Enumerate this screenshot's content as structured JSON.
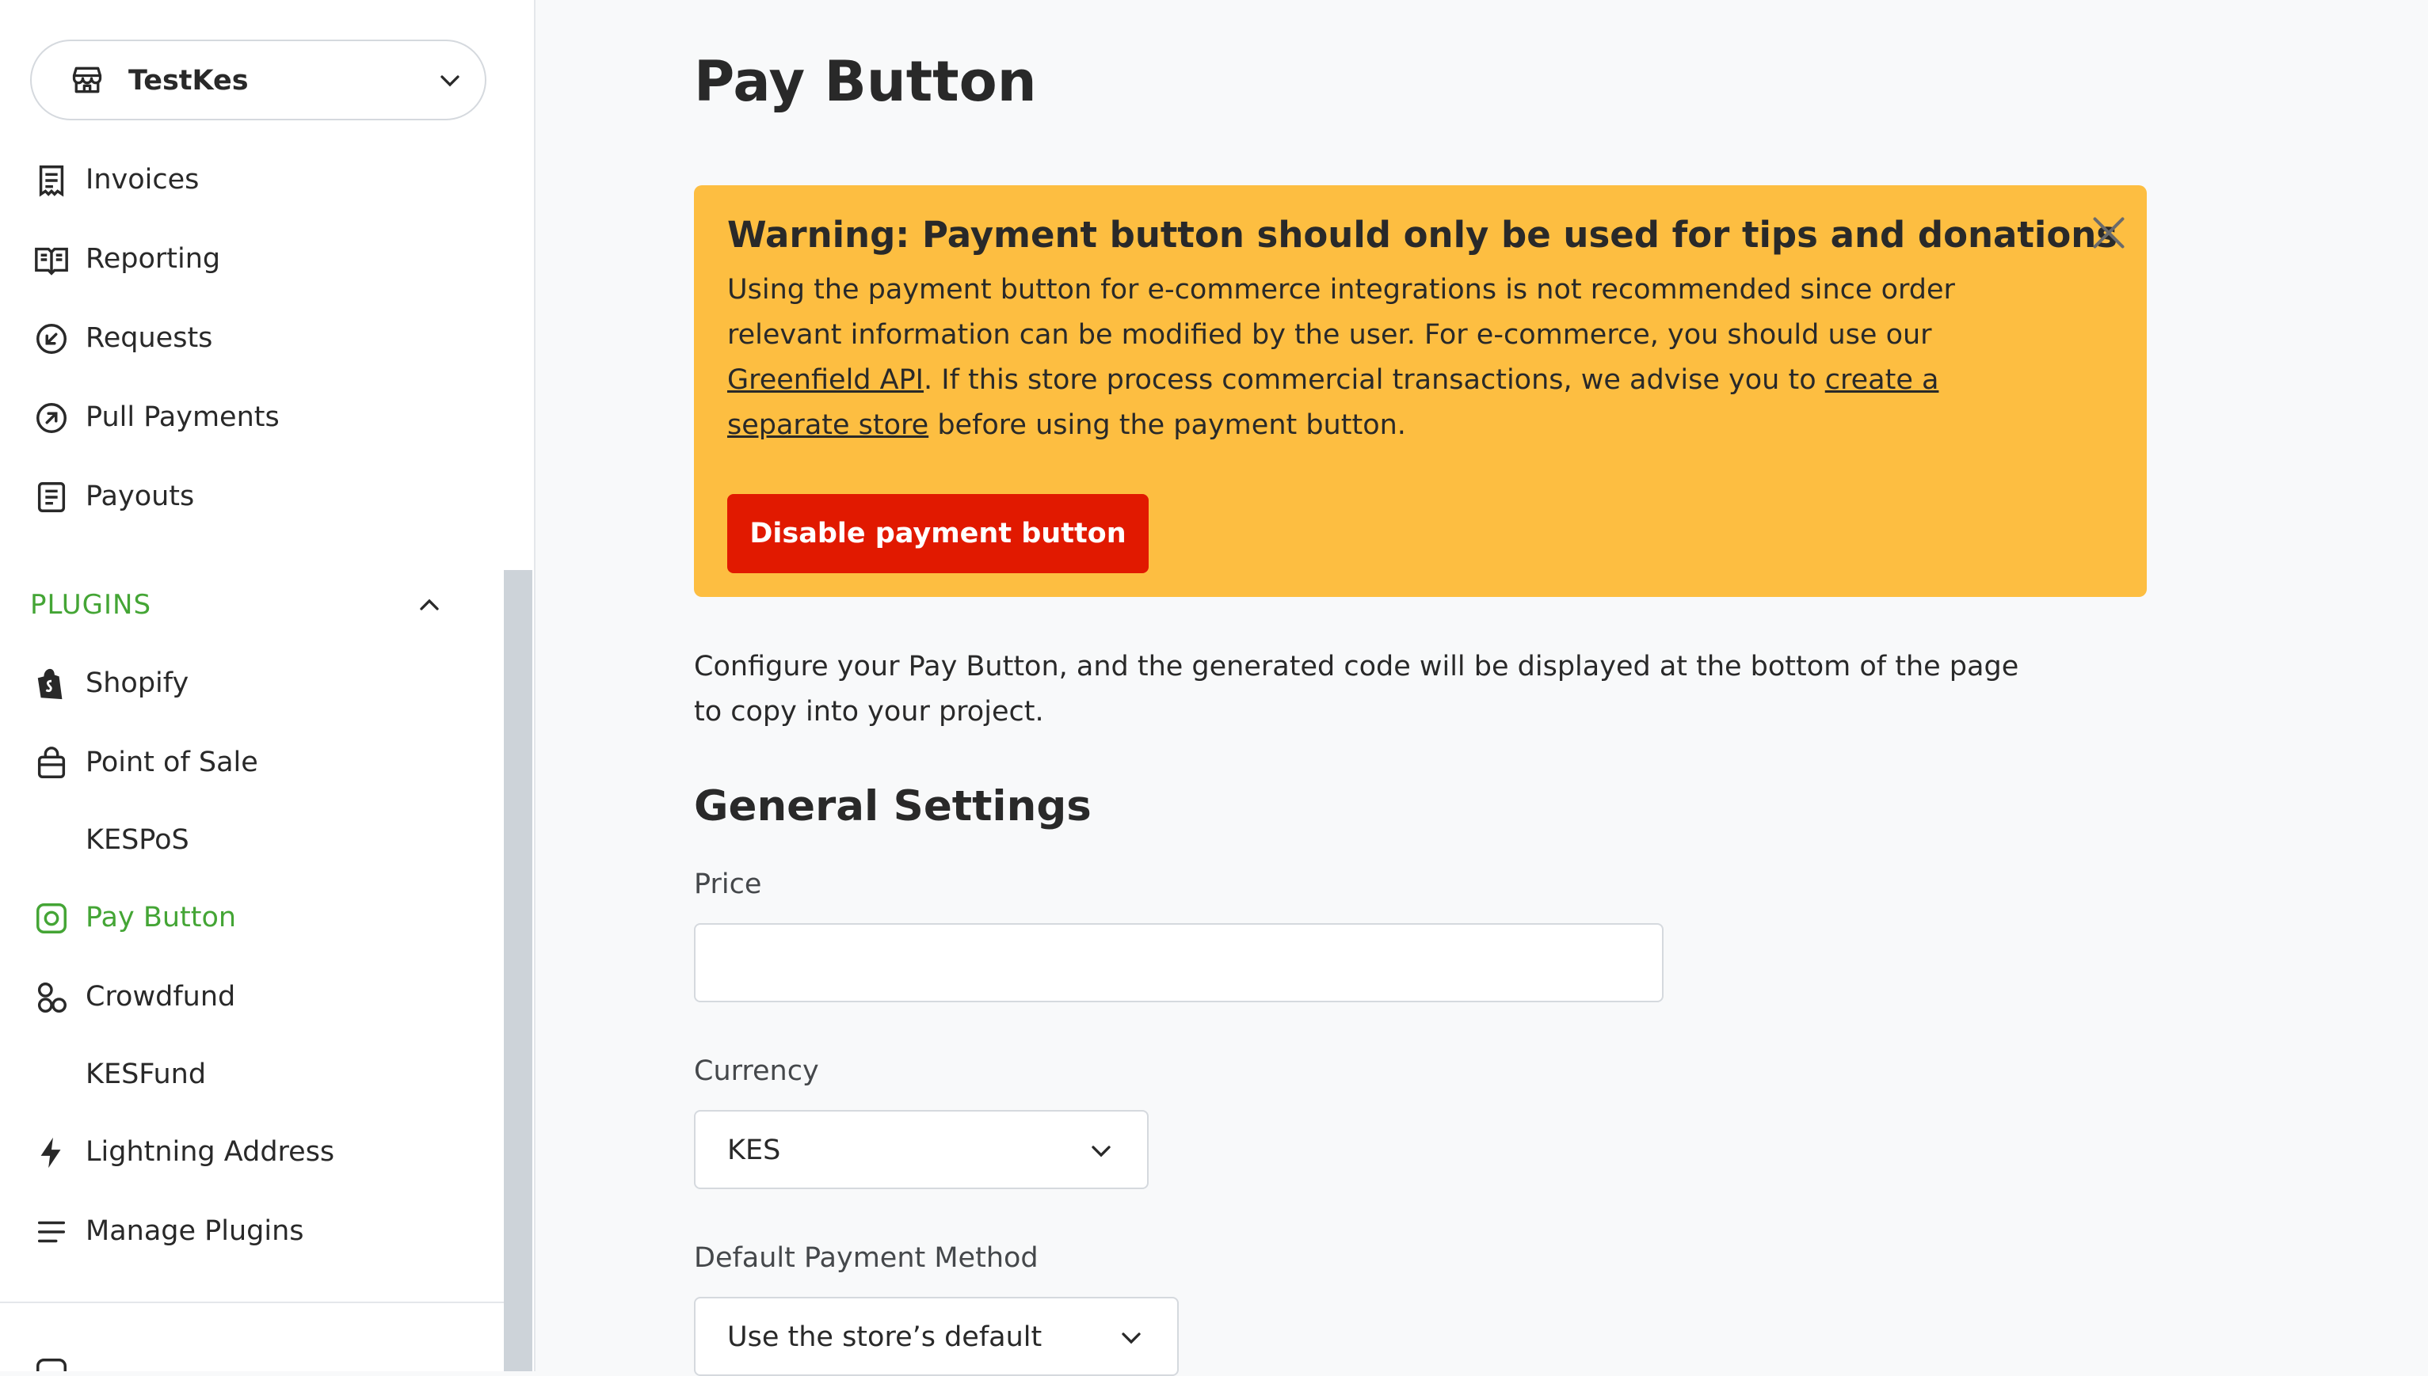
{
  "store_selector": {
    "name": "TestKes"
  },
  "nav": {
    "items": [
      {
        "label": "Invoices",
        "icon": "invoice-icon"
      },
      {
        "label": "Reporting",
        "icon": "book-icon"
      },
      {
        "label": "Requests",
        "icon": "arrow-in-circle-icon"
      },
      {
        "label": "Pull Payments",
        "icon": "arrow-out-circle-icon"
      },
      {
        "label": "Payouts",
        "icon": "document-icon"
      }
    ],
    "plugins_title": "PLUGINS",
    "plugin_items": [
      {
        "label": "Shopify",
        "icon": "shopify-icon"
      },
      {
        "label": "Point of Sale",
        "icon": "pos-icon"
      },
      {
        "label": "KESPoS",
        "icon": ""
      },
      {
        "label": "Pay Button",
        "icon": "pay-button-icon",
        "active": true
      },
      {
        "label": "Crowdfund",
        "icon": "crowdfund-icon"
      },
      {
        "label": "KESFund",
        "icon": ""
      },
      {
        "label": "Lightning Address",
        "icon": "lightning-icon"
      },
      {
        "label": "Manage Plugins",
        "icon": "list-icon"
      }
    ],
    "active_color": "#44a535"
  },
  "page": {
    "title": "Pay Button",
    "alert": {
      "title": "Warning: Payment button should only be used for tips and donations",
      "body_1": "Using the payment button for e-commerce integrations is not recommended since order relevant information can be modified by the user. For e-commerce, you should use our ",
      "link_1": "Greenfield API",
      "body_2": ". If this store process commercial transactions, we advise you to ",
      "link_2": "create a separate store",
      "body_3": " before using the payment button.",
      "button": "Disable payment button",
      "bg_color": "#fdbe41",
      "button_color": "#e11900"
    },
    "intro": "Configure your Pay Button, and the generated code will be displayed at the bottom of the page to copy into your project.",
    "general_settings": {
      "heading": "General Settings",
      "price_label": "Price",
      "price_value": "",
      "currency_label": "Currency",
      "currency_value": "KES",
      "payment_method_label": "Default Payment Method",
      "payment_method_value": "Use the store’s default"
    }
  }
}
